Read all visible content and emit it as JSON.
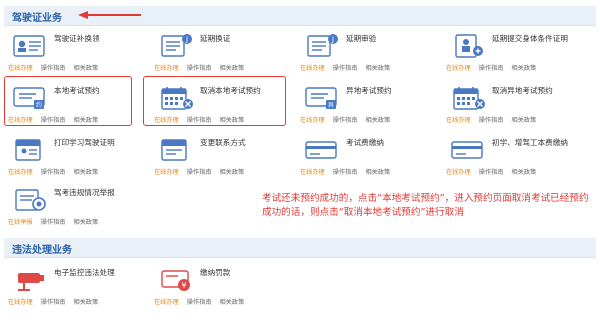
{
  "sections": {
    "license": {
      "title": "驾驶证业务"
    },
    "violation": {
      "title": "违法处理业务"
    }
  },
  "link_labels": {
    "online": "在线办理",
    "guide": "操作指南",
    "policy": "相关政策",
    "report": "在线举报"
  },
  "tiles": [
    {
      "name": "驾驶证补换领",
      "icon": "license-card-icon"
    },
    {
      "name": "延期换证",
      "icon": "renew-document-icon"
    },
    {
      "name": "延期审验",
      "icon": "extend-review-icon"
    },
    {
      "name": "延期提交身体条件证明",
      "icon": "health-certificate-icon"
    },
    {
      "name": "本地考试预约",
      "icon": "exam-booking-icon"
    },
    {
      "name": "取消本地考试预约",
      "icon": "calendar-cancel-icon"
    },
    {
      "name": "异地考试预约",
      "icon": "remote-exam-booking-icon"
    },
    {
      "name": "取消异地考试预约",
      "icon": "calendar-cancel-remote-icon"
    },
    {
      "name": "打印学习驾驶证明",
      "icon": "print-permit-icon"
    },
    {
      "name": "变更联系方式",
      "icon": "contact-change-icon"
    },
    {
      "name": "考试费缴纳",
      "icon": "exam-fee-icon"
    },
    {
      "name": "初学、增驾工本费缴纳",
      "icon": "fee-payment-icon"
    },
    {
      "name": "驾考违规情况举报",
      "icon": "report-violation-icon"
    },
    {
      "name": "电子监控违法处理",
      "icon": "traffic-camera-icon"
    },
    {
      "name": "缴纳罚款",
      "icon": "fine-payment-icon"
    }
  ],
  "annotation": {
    "text": "考试还未预约成功的，点击“本地考试预约”，进入预约页面取消考试已经预约成功的话，则点击“取消本地考试预约”进行取消"
  },
  "colors": {
    "accent": "#2d63a8",
    "online": "#e08a1a",
    "highlight": "#e53935"
  }
}
